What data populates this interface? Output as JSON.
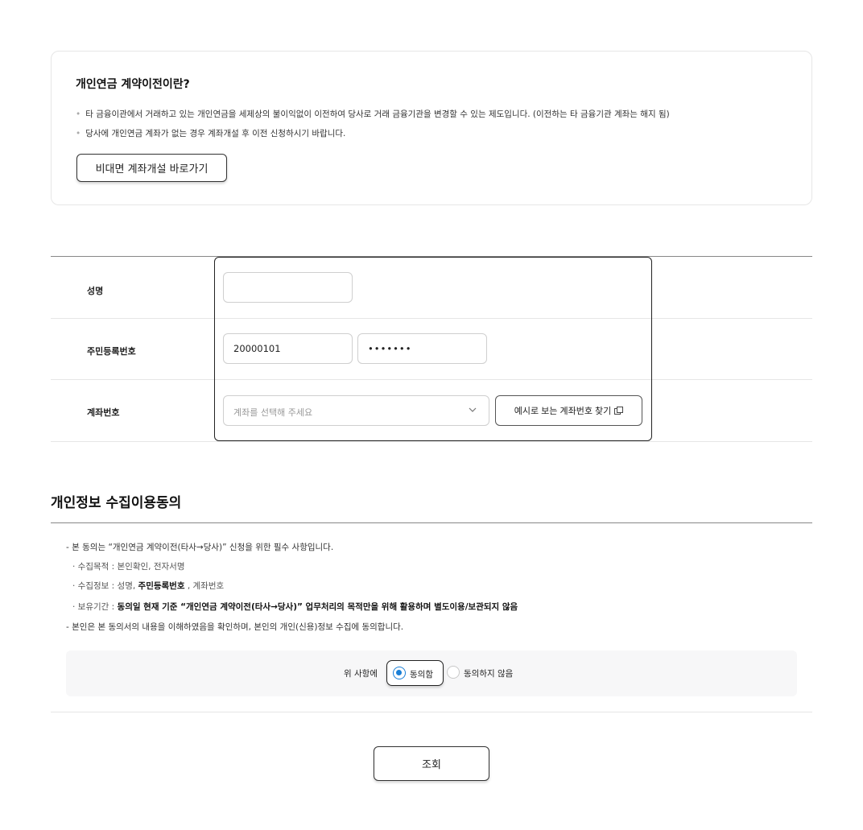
{
  "info": {
    "title": "개인연금 계약이전이란?",
    "bullets": [
      "타 금융이관에서 거래하고 있는 개인연금을 세제상의 불이익없이 이전하여 당사로 거래 금융기관을 변경할 수 있는 제도입니다. (이전하는 타 금융기관 계좌는 해지 됨)",
      "당사에 개인연금 계좌가 없는 경우 계좌개설 후 이전 신청하시기 바랍니다."
    ],
    "bullet_marker": "•",
    "open_account_button": "비대면 계좌개설 바로가기"
  },
  "form": {
    "name_label": "성명",
    "name_value": "",
    "rrn_label": "주민등록번호",
    "rrn_front": "20000101",
    "rrn_back": "•••••••",
    "account_label": "계좌번호",
    "account_placeholder": "계좌를 선택해 주세요",
    "find_account_button": "예시로 보는 계좌번호 찾기"
  },
  "consent": {
    "title": "개인정보 수집이용동의",
    "line1": "- 본 동의는 “개인연금 계약이전(타사→당사)” 신청을 위한 필수 사항입니다.",
    "purpose": "· 수집목적 : 본인확인, 전자서명",
    "info_prefix": "· 수집정보 : 성명, ",
    "info_bold": "주민등록번호",
    "info_suffix": " , 계좌번호",
    "period_prefix": "· 보유기간 : ",
    "period_bold": "동의일 현재 기준 “개인연금 계약이전(타사→당사)” 업무처리의 목적만을 위해 활용하며 별도이용/보관되지 않음",
    "line5": "- 본인은 본 동의서의 내용을 이해하였음을 확인하며, 본인의 개인(신용)정보 수집에 동의합니다.",
    "question": "위 사항에",
    "agree": "동의함",
    "disagree": "동의하지 않음"
  },
  "submit_button": "조회",
  "colors": {
    "accent": "#1a7fd6",
    "border_dark": "#222222",
    "border_light": "#e6e6e6",
    "consent_bg": "#f7f7f8"
  }
}
